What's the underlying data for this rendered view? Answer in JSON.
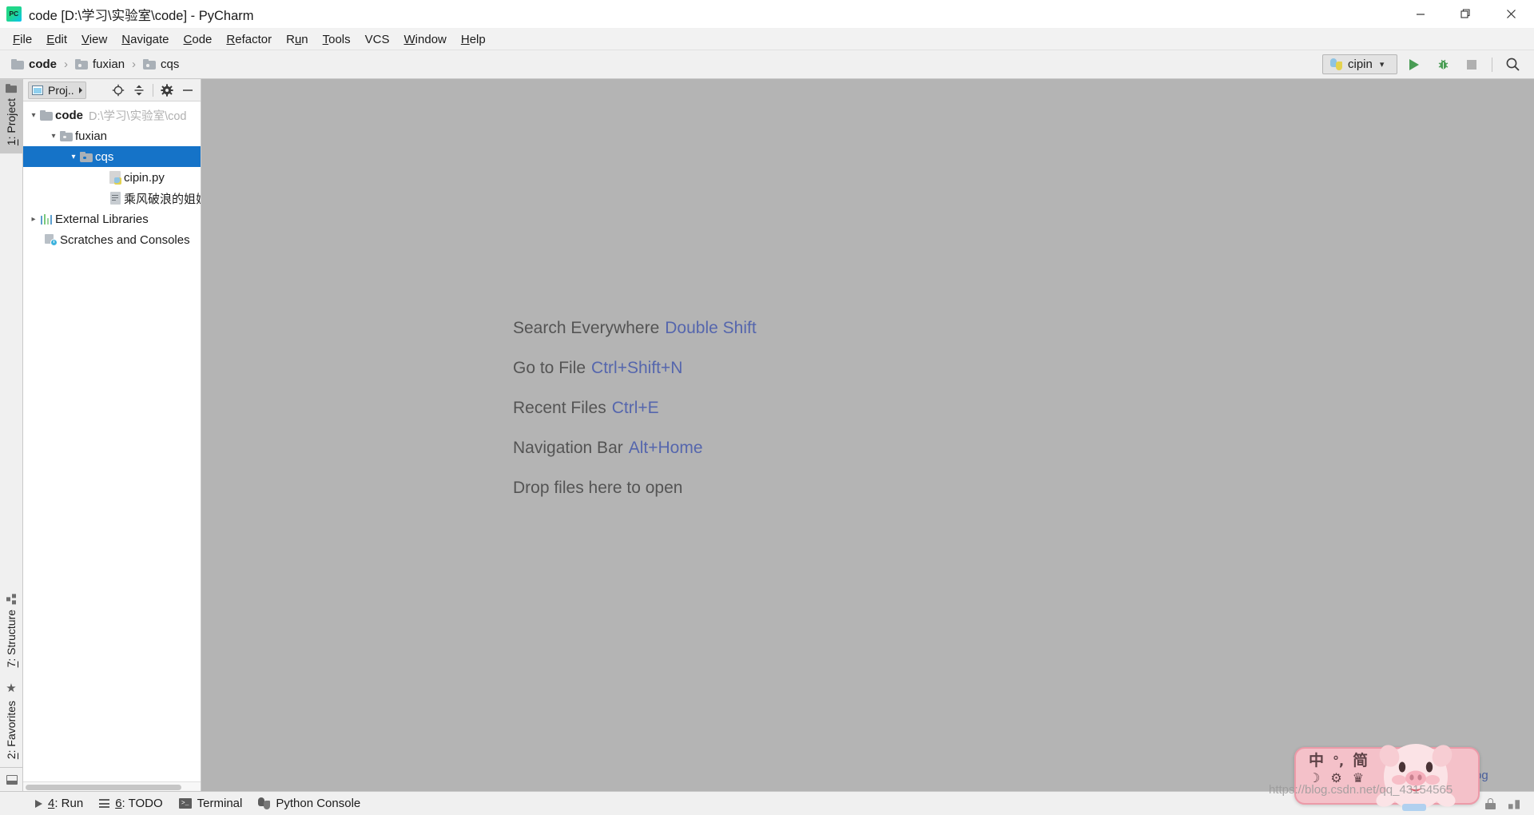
{
  "window": {
    "title": "code [D:\\学习\\实验室\\code] - PyCharm",
    "app_logo": "pycharm-logo",
    "minimize_label": "Minimize",
    "maximize_label": "Restore",
    "close_label": "Close"
  },
  "menubar": {
    "items": [
      {
        "label": "File",
        "mnemonic": "F"
      },
      {
        "label": "Edit",
        "mnemonic": "E"
      },
      {
        "label": "View",
        "mnemonic": "V"
      },
      {
        "label": "Navigate",
        "mnemonic": "N"
      },
      {
        "label": "Code",
        "mnemonic": "C"
      },
      {
        "label": "Refactor",
        "mnemonic": "R"
      },
      {
        "label": "Run",
        "mnemonic": "u"
      },
      {
        "label": "Tools",
        "mnemonic": "T"
      },
      {
        "label": "VCS",
        "mnemonic": ""
      },
      {
        "label": "Window",
        "mnemonic": "W"
      },
      {
        "label": "Help",
        "mnemonic": "H"
      }
    ]
  },
  "navbar": {
    "breadcrumb": [
      {
        "label": "code",
        "icon": "folder-icon"
      },
      {
        "label": "fuxian",
        "icon": "folder-icon"
      },
      {
        "label": "cqs",
        "icon": "folder-icon"
      }
    ],
    "separator": "›",
    "run_config": {
      "name": "cipin",
      "icon": "python-icon",
      "chevron": "⌄"
    },
    "buttons": [
      {
        "name": "run-button",
        "icon": "play-icon"
      },
      {
        "name": "debug-button",
        "icon": "bug-icon"
      },
      {
        "name": "stop-button",
        "icon": "stop-icon"
      },
      {
        "name": "search-button",
        "icon": "search-icon"
      }
    ]
  },
  "left_tabs": {
    "top": [
      {
        "label": "1: Project",
        "mnemonic": "1",
        "icon": "folder-icon",
        "active": true
      }
    ],
    "bottom": [
      {
        "label": "7: Structure",
        "mnemonic": "7",
        "icon": "structure-icon",
        "active": false
      },
      {
        "label": "2: Favorites",
        "mnemonic": "2",
        "icon": "star-icon",
        "active": false
      }
    ],
    "bottom_button": {
      "name": "hide-windows-button",
      "icon": "window-icon"
    }
  },
  "project_panel": {
    "title": "Proj..",
    "title_icon": "window-icon",
    "dropdown_icon": "triangle-down-icon",
    "toolbar": [
      {
        "name": "locate-button",
        "icon": "crosshair-icon"
      },
      {
        "name": "collapse-all-button",
        "icon": "collapse-icon"
      },
      {
        "name": "settings-button",
        "icon": "gear-icon"
      },
      {
        "name": "hide-button",
        "icon": "minimize-icon"
      }
    ],
    "tree": [
      {
        "label": "code",
        "path": "D:\\学习\\实验室\\cod",
        "icon": "folder-icon",
        "arrow": "expanded",
        "indent": 0,
        "bold": true,
        "selected": false
      },
      {
        "label": "fuxian",
        "path": "",
        "icon": "folder-icon",
        "arrow": "expanded",
        "indent": 1,
        "bold": false,
        "selected": false
      },
      {
        "label": "cqs",
        "path": "",
        "icon": "folder-icon",
        "arrow": "expanded",
        "indent": 2,
        "bold": false,
        "selected": true
      },
      {
        "label": "cipin.py",
        "path": "",
        "icon": "python-file-icon",
        "arrow": "none",
        "indent": 3,
        "bold": false,
        "selected": false
      },
      {
        "label": "乘风破浪的姐姐",
        "path": "",
        "icon": "text-file-icon",
        "arrow": "none",
        "indent": 3,
        "bold": false,
        "selected": false
      },
      {
        "label": "External Libraries",
        "path": "",
        "icon": "library-icon",
        "arrow": "collapsed",
        "indent": 0,
        "bold": false,
        "selected": false
      },
      {
        "label": "Scratches and Consoles",
        "path": "",
        "icon": "scratches-icon",
        "arrow": "none",
        "indent": 0,
        "bold": false,
        "selected": false
      }
    ]
  },
  "editor": {
    "welcome_rows": [
      {
        "label": "Search Everywhere",
        "key": "Double Shift"
      },
      {
        "label": "Go to File",
        "key": "Ctrl+Shift+N"
      },
      {
        "label": "Recent Files",
        "key": "Ctrl+E"
      },
      {
        "label": "Navigation Bar",
        "key": "Alt+Home"
      },
      {
        "label": "Drop files here to open",
        "key": ""
      }
    ],
    "background_color": "#b4b4b4",
    "label_color": "#545454",
    "key_color": "#5566ad"
  },
  "statusbar": {
    "items": [
      {
        "label": "4: Run",
        "mnemonic": "4",
        "icon": "play-icon"
      },
      {
        "label": "6: TODO",
        "mnemonic": "6",
        "icon": "list-icon"
      },
      {
        "label": "Terminal",
        "mnemonic": "",
        "icon": "terminal-icon"
      },
      {
        "label": "Python Console",
        "mnemonic": "",
        "icon": "python-icon"
      }
    ],
    "right_hidden_text": "og",
    "bottom_button": {
      "name": "toggle-toolwindows-button",
      "icon": "window-icon"
    }
  },
  "ime_widget": {
    "name": "sogou-input-method-toolbar",
    "row1": [
      "中",
      "°,",
      "简"
    ],
    "row2": [
      "☽",
      "⚙",
      "♛"
    ],
    "mascot": "pig-mascot-icon",
    "accent_color": "#f4c1c9"
  },
  "watermark": {
    "text": "https://blog.csdn.net/qq_43154565"
  }
}
